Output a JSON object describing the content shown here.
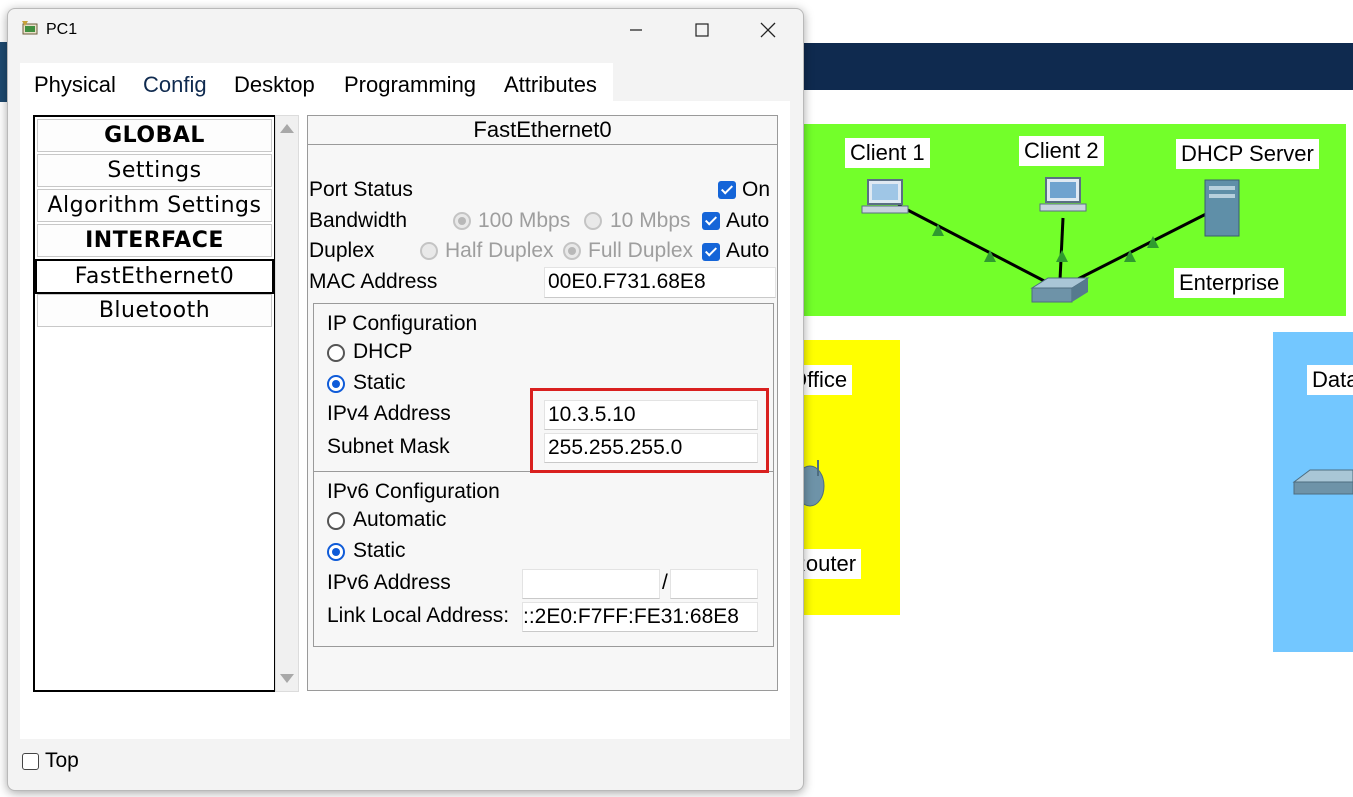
{
  "window": {
    "title": "PC1",
    "tabs": [
      {
        "label": "Physical"
      },
      {
        "label": "Config"
      },
      {
        "label": "Desktop"
      },
      {
        "label": "Programming"
      },
      {
        "label": "Attributes"
      }
    ],
    "active_tab": "Config"
  },
  "menu": {
    "items": [
      {
        "label": "GLOBAL"
      },
      {
        "label": "Settings"
      },
      {
        "label": "Algorithm Settings"
      },
      {
        "label": "INTERFACE"
      },
      {
        "label": "FastEthernet0"
      },
      {
        "label": "Bluetooth"
      }
    ]
  },
  "interface": {
    "title": "FastEthernet0",
    "port_status_label": "Port Status",
    "port_on_label": "On",
    "bandwidth_label": "Bandwidth",
    "bw_100": "100 Mbps",
    "bw_10": "10 Mbps",
    "bw_auto": "Auto",
    "duplex_label": "Duplex",
    "half_duplex": "Half Duplex",
    "full_duplex": "Full Duplex",
    "duplex_auto": "Auto",
    "mac_label": "MAC Address",
    "mac_value": "00E0.F731.68E8"
  },
  "ip_config": {
    "title": "IP Configuration",
    "dhcp_label": "DHCP",
    "static_label": "Static",
    "ipv4_label": "IPv4 Address",
    "ipv4_value": "10.3.5.10",
    "subnet_label": "Subnet Mask",
    "subnet_value": "255.255.255.0"
  },
  "ipv6_config": {
    "title": "IPv6 Configuration",
    "automatic_label": "Automatic",
    "static_label": "Static",
    "ipv6_label": "IPv6 Address",
    "ipv6_value": "",
    "prefix_separator": "/",
    "prefix_value": "",
    "link_local_label": "Link Local Address:",
    "link_local_value": "::2E0:F7FF:FE31:68E8"
  },
  "footer": {
    "top_label": "Top"
  },
  "topology": {
    "labels": {
      "client1": "Client 1",
      "client2": "Client 2",
      "dhcp_server": "DHCP Server",
      "enterprise": "Enterprise",
      "office": "Office",
      "router": "Router",
      "data": "Data"
    },
    "colors": {
      "enterprise_zone": "#73ff2a",
      "office_zone": "#ffff00",
      "data_zone": "#73c7ff",
      "highlight": "#d9201f"
    }
  }
}
